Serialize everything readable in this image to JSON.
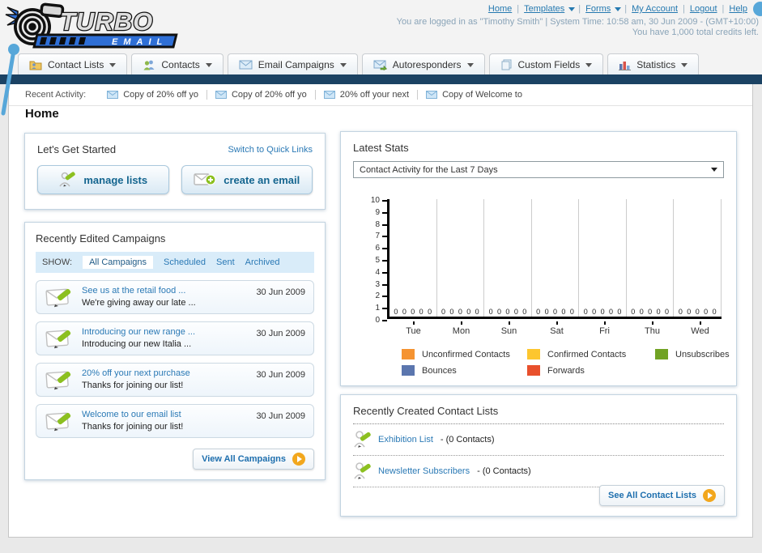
{
  "page": {
    "heading": "Home"
  },
  "colors": {
    "navy_bar": "#1b4263",
    "link_blue": "#2579b0",
    "accent_orange": "#f2a71d",
    "logo_blue": "#2f6fd6",
    "deco_dot_blue": "#57a7d9"
  },
  "header": {
    "brand": {
      "name": "TURBO",
      "sub": "EMAIL"
    },
    "separator": "|",
    "links": [
      {
        "label": "Home"
      },
      {
        "label": "Templates",
        "dropdown": true
      },
      {
        "label": "Forms",
        "dropdown": true
      },
      {
        "label": "My Account"
      },
      {
        "label": "Logout"
      },
      {
        "label": "Help"
      }
    ],
    "login_line": "You are logged in as \"Timothy Smith\" | System Time: 10:58 am, 30 Jun 2009 - (GMT+10:00)",
    "credits_line": "You have 1,000 total credits left."
  },
  "nav": {
    "tabs": [
      {
        "label": "Contact Lists"
      },
      {
        "label": "Contacts"
      },
      {
        "label": "Email Campaigns"
      },
      {
        "label": "Autoresponders"
      },
      {
        "label": "Custom Fields"
      },
      {
        "label": "Statistics"
      }
    ]
  },
  "recent_activity": {
    "label": "Recent Activity:",
    "items": [
      {
        "text": "Copy of 20% off yo"
      },
      {
        "text": "Copy of 20% off yo"
      },
      {
        "text": "20% off your next"
      },
      {
        "text": "Copy of Welcome to"
      }
    ]
  },
  "get_started": {
    "title": "Let's Get Started",
    "switch_link": "Switch to Quick Links",
    "buttons": [
      {
        "label": "manage lists"
      },
      {
        "label": "create an email"
      }
    ]
  },
  "campaigns": {
    "title": "Recently Edited Campaigns",
    "show_label": "SHOW:",
    "filters": [
      {
        "label": "All Campaigns",
        "selected": true
      },
      {
        "label": "Scheduled"
      },
      {
        "label": "Sent"
      },
      {
        "label": "Archived"
      }
    ],
    "items": [
      {
        "title": "See us at the retail food ...",
        "subtitle": "We're giving away our late ...",
        "date": "30 Jun 2009"
      },
      {
        "title": "Introducing our new range ...",
        "subtitle": "Introducing our new Italia ...",
        "date": "30 Jun 2009"
      },
      {
        "title": "20% off your next purchase",
        "subtitle": "Thanks for joining our list!",
        "date": "30 Jun 2009"
      },
      {
        "title": "Welcome to our email list",
        "subtitle": "Thanks for joining our list!",
        "date": "30 Jun 2009"
      }
    ],
    "view_all_label": "View All Campaigns"
  },
  "stats": {
    "title": "Latest Stats",
    "selected_option": "Contact Activity for the Last 7 Days"
  },
  "chart_data": {
    "type": "bar",
    "title": "Contact Activity for the Last 7 Days",
    "categories": [
      "Tue",
      "Mon",
      "Sun",
      "Sat",
      "Fri",
      "Thu",
      "Wed"
    ],
    "series": [
      {
        "name": "Unconfirmed Contacts",
        "color": "#f59331",
        "values": [
          0,
          0,
          0,
          0,
          0,
          0,
          0
        ]
      },
      {
        "name": "Confirmed Contacts",
        "color": "#fdc62f",
        "values": [
          0,
          0,
          0,
          0,
          0,
          0,
          0
        ]
      },
      {
        "name": "Unsubscribes",
        "color": "#71a324",
        "values": [
          0,
          0,
          0,
          0,
          0,
          0,
          0
        ]
      },
      {
        "name": "Bounces",
        "color": "#5b76ae",
        "values": [
          0,
          0,
          0,
          0,
          0,
          0,
          0
        ]
      },
      {
        "name": "Forwards",
        "color": "#e8502c",
        "values": [
          0,
          0,
          0,
          0,
          0,
          0,
          0
        ]
      }
    ],
    "ylim": [
      0,
      10
    ],
    "y_ticks": [
      0,
      1,
      2,
      3,
      4,
      5,
      6,
      7,
      8,
      9,
      10
    ],
    "grid": "vertical-between-groups",
    "legend_position": "bottom",
    "value_labels_shown": true
  },
  "contact_lists": {
    "title": "Recently Created Contact Lists",
    "items": [
      {
        "name": "Exhibition List",
        "count": "- (0 Contacts)"
      },
      {
        "name": "Newsletter Subscribers",
        "count": "- (0 Contacts)"
      }
    ],
    "see_all_label": "See All Contact Lists"
  }
}
